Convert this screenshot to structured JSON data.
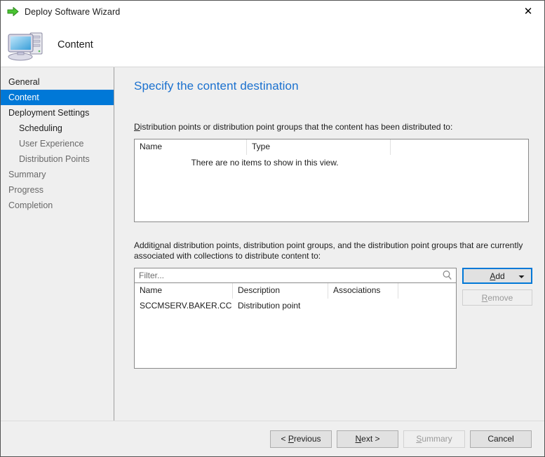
{
  "window": {
    "title": "Deploy Software Wizard",
    "title_icon": "green-arrow-icon",
    "close_label": "✕"
  },
  "wizard_header": {
    "title": "Content",
    "icon": "computer-icon"
  },
  "sidebar": {
    "items": [
      {
        "label": "General",
        "state": "normal",
        "level": 0
      },
      {
        "label": "Content",
        "state": "selected",
        "level": 0
      },
      {
        "label": "Deployment Settings",
        "state": "normal",
        "level": 0
      },
      {
        "label": "Scheduling",
        "state": "normal",
        "level": 1
      },
      {
        "label": "User Experience",
        "state": "dim",
        "level": 1
      },
      {
        "label": "Distribution Points",
        "state": "dim",
        "level": 1
      },
      {
        "label": "Summary",
        "state": "dim",
        "level": 0
      },
      {
        "label": "Progress",
        "state": "dim",
        "level": 0
      },
      {
        "label": "Completion",
        "state": "dim",
        "level": 0
      }
    ]
  },
  "main": {
    "heading": "Specify the content destination",
    "distributed_label_accel": "D",
    "distributed_label_rest": "istribution points or distribution point groups that the content has been distributed to:",
    "additional_label_pre": "Additi",
    "additional_label_accel": "o",
    "additional_label_rest": "nal distribution points, distribution point groups, and the distribution point groups that are currently associated with collections to distribute content to:",
    "top_list": {
      "columns": [
        "Name",
        "Type",
        ""
      ],
      "empty_message": "There are no items to show in this view.",
      "rows": []
    },
    "bottom_list": {
      "columns": [
        "Name",
        "Description",
        "Associations",
        ""
      ],
      "rows": [
        {
          "name": "SCCMSERV.BAKER.CC",
          "description": "Distribution point",
          "associations": ""
        }
      ]
    },
    "filter": {
      "placeholder": "Filter...",
      "value": "",
      "icon": "search-icon"
    },
    "add_button": {
      "pre": "",
      "accel": "A",
      "rest": "dd",
      "caret_icon": "chevron-down-icon",
      "focused": true
    },
    "remove_button": {
      "accel": "R",
      "rest": "emove",
      "disabled": true
    }
  },
  "footer": {
    "previous": {
      "pre": "< ",
      "accel": "P",
      "rest": "revious",
      "disabled": false
    },
    "next": {
      "pre": "",
      "accel": "N",
      "rest": "ext >",
      "disabled": false
    },
    "summary": {
      "pre": "",
      "accel": "S",
      "rest": "ummary",
      "disabled": true
    },
    "cancel": {
      "pre": "",
      "accel": "",
      "rest": "Cancel",
      "disabled": false
    }
  },
  "colors": {
    "accent": "#0078d7",
    "heading": "#1b71cf",
    "panel": "#efefef"
  }
}
